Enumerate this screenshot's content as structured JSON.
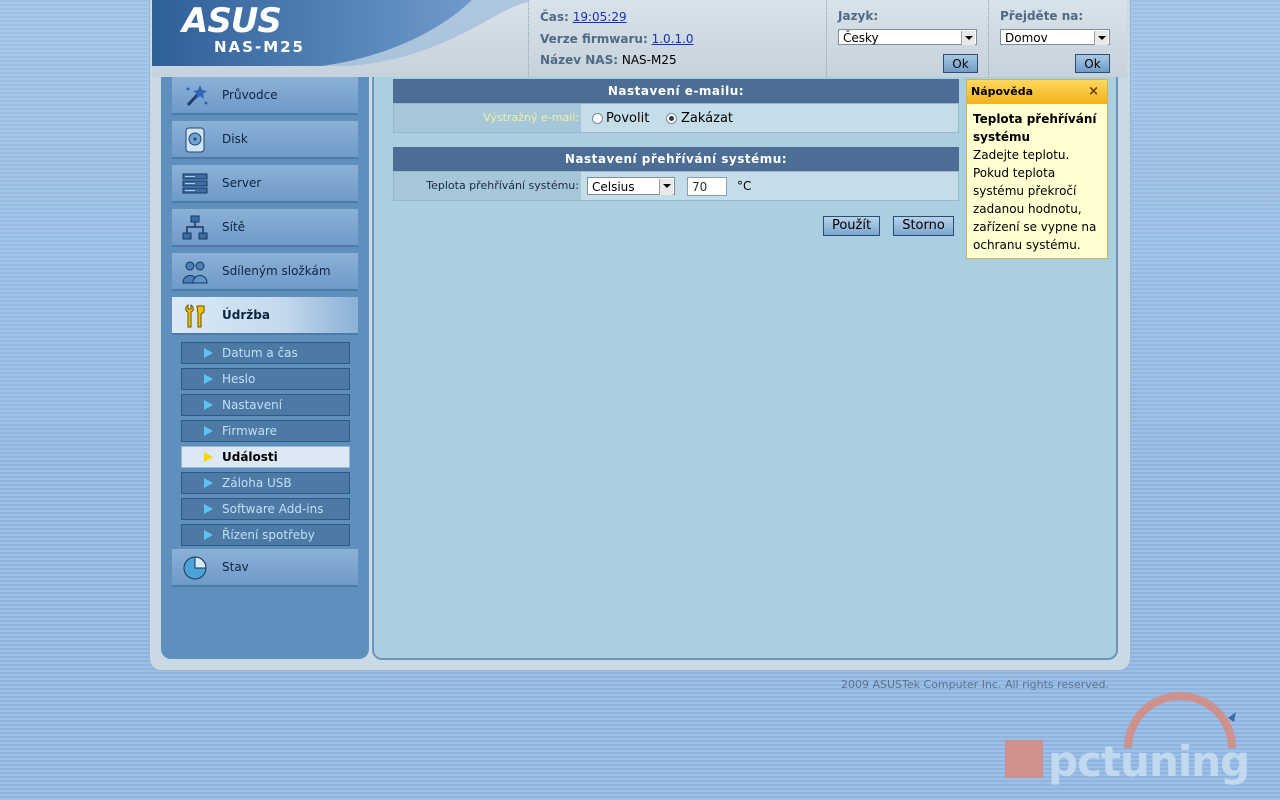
{
  "brand": {
    "logo": "ASUS",
    "model": "NAS-M25"
  },
  "header_info": {
    "time_label": "Čas:",
    "time_value": "19:05:29",
    "firmware_label": "Verze firmwaru:",
    "firmware_value": "1.0.1.0",
    "nas_name_label": "Název NAS:",
    "nas_name_value": "NAS-M25"
  },
  "language": {
    "label": "Jazyk:",
    "selected": "Česky",
    "ok_label": "Ok"
  },
  "goto": {
    "label": "Přejděte na:",
    "selected": "Domov",
    "ok_label": "Ok"
  },
  "sidebar": {
    "items": [
      {
        "label": "Průvodce",
        "icon": "wizard-wand-icon"
      },
      {
        "label": "Disk",
        "icon": "disk-icon"
      },
      {
        "label": "Server",
        "icon": "server-icon"
      },
      {
        "label": "Sítě",
        "icon": "network-icon"
      },
      {
        "label": "Sdíleným složkám",
        "icon": "shared-folders-icon"
      },
      {
        "label": "Údržba",
        "icon": "maintenance-tools-icon",
        "active": true
      },
      {
        "label": "Stav",
        "icon": "status-icon"
      }
    ],
    "subitems": [
      {
        "label": "Datum a čas"
      },
      {
        "label": "Heslo"
      },
      {
        "label": "Nastavení"
      },
      {
        "label": "Firmware"
      },
      {
        "label": "Události",
        "active": true
      },
      {
        "label": "Záloha USB"
      },
      {
        "label": "Software Add-ins"
      },
      {
        "label": "Řízení spotřeby"
      }
    ]
  },
  "email_section": {
    "title": "Nastavení e-mailu:",
    "field_label": "Výstražný e-mail:",
    "option_enable": "Povolit",
    "option_disable": "Zakázat",
    "selected": "Zakázat"
  },
  "overheat_section": {
    "title": "Nastavení přehřívání systému:",
    "field_label": "Teplota přehřívání systému:",
    "unit_select": "Celsius",
    "temperature_value": "70",
    "unit_suffix": "°C"
  },
  "buttons": {
    "apply": "Použít",
    "cancel": "Storno"
  },
  "help": {
    "title": "Nápověda",
    "close": "×",
    "heading": "Teplota přehřívání systému",
    "text": "Zadejte teplotu. Pokud teplota systému překročí zadanou hodnotu, zařízení se vypne na ochranu systému."
  },
  "footer": {
    "copyright": "2009 ASUSTek Computer Inc. All rights reserved."
  },
  "watermark": {
    "text": "pctuning"
  },
  "colors": {
    "header_blue": "#3c6ea6",
    "sidebar": "#5f8fbd",
    "section_title": "#4c6e94",
    "help_bg": "#ffffd2",
    "help_head": "#f2b21e"
  }
}
